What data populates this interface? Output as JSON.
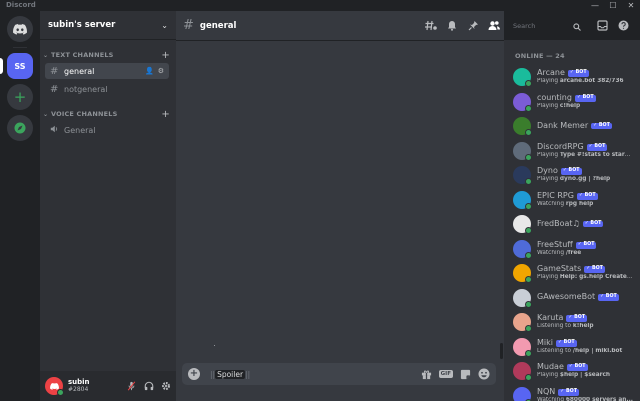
{
  "window": {
    "app_title": "Discord",
    "minimize": "—",
    "maximize": "☐",
    "close": "✕"
  },
  "server": {
    "name": "subin's server",
    "initials": "SS"
  },
  "rail": {
    "add": "+"
  },
  "categories": {
    "text": "TEXT CHANNELS",
    "voice": "VOICE CHANNELS"
  },
  "channels": {
    "general": "general",
    "notgeneral": "notgeneral",
    "voice_general": "General"
  },
  "user": {
    "name": "subin",
    "tag": "#2804"
  },
  "chat": {
    "channel": "general",
    "draft_prefix": "||",
    "draft_spoiler": "Spoiler",
    "draft_suffix": "||",
    "gif": "GIF"
  },
  "search": {
    "placeholder": "Search"
  },
  "members": {
    "header": "ONLINE — 24",
    "bot_badge": "✓ BOT",
    "list": [
      {
        "name": "Arcane",
        "verb": "Playing",
        "activity": "arcane.bot 382/736",
        "color": "#1abc9c",
        "bot": true
      },
      {
        "name": "counting",
        "verb": "Playing",
        "activity": "c!help",
        "color": "#7b5cd6",
        "bot": true
      },
      {
        "name": "Dank Memer",
        "verb": "",
        "activity": "",
        "color": "#3a7d2c",
        "bot": true
      },
      {
        "name": "DiscordRPG",
        "verb": "Playing",
        "activity": "Type #!stats to start y...",
        "color": "#5f6b7a",
        "bot": true
      },
      {
        "name": "Dyno",
        "verb": "Playing",
        "activity": "dyno.gg | ?help",
        "color": "#2a3a5c",
        "bot": true
      },
      {
        "name": "EPIC RPG",
        "verb": "Watching",
        "activity": "rpg help",
        "color": "#1f9bd6",
        "bot": true
      },
      {
        "name": "FredBoat♫",
        "verb": "",
        "activity": "",
        "color": "#e8e8e8",
        "bot": true
      },
      {
        "name": "FreeStuff",
        "verb": "Watching",
        "activity": "/free",
        "color": "#4f6bd8",
        "bot": true
      },
      {
        "name": "GameStats",
        "verb": "Playing",
        "activity": "Help: gs.help Create pr...",
        "color": "#f0a500",
        "bot": true
      },
      {
        "name": "GAwesomeBot",
        "verb": "",
        "activity": "",
        "color": "#c9ced6",
        "bot": true
      },
      {
        "name": "Karuta",
        "verb": "Listening to",
        "activity": "k!help",
        "color": "#e8a48c",
        "bot": true
      },
      {
        "name": "Miki",
        "verb": "Listening to",
        "activity": "/help | miki.bot",
        "color": "#f29ab0",
        "bot": true
      },
      {
        "name": "Mudae",
        "verb": "Playing",
        "activity": "$help | $search",
        "color": "#b03a5b",
        "bot": true
      },
      {
        "name": "NQN",
        "verb": "Watching",
        "activity": "680000 servers an...",
        "color": "#5865f2",
        "bot": true
      }
    ]
  }
}
